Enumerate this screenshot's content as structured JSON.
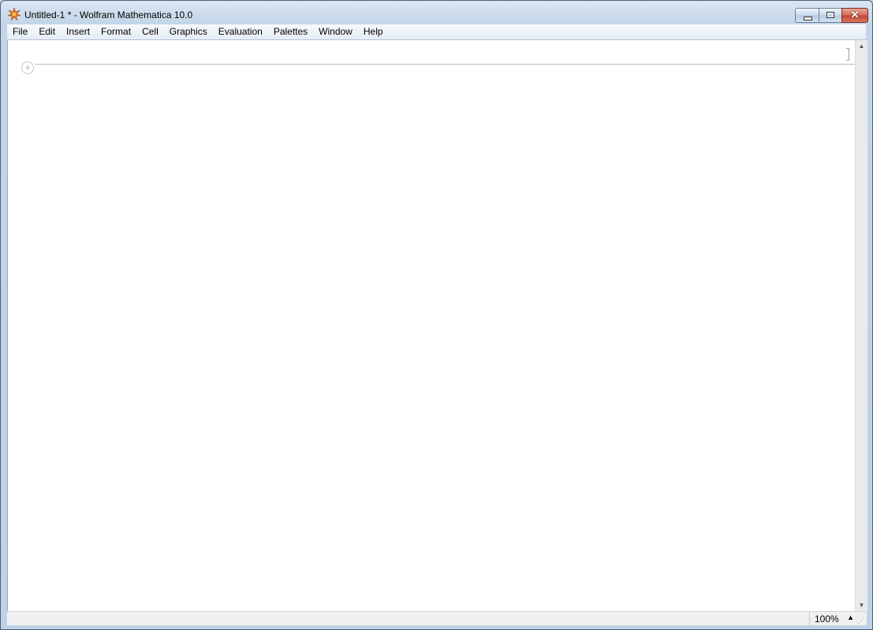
{
  "window": {
    "title": "Untitled-1 * - Wolfram Mathematica 10.0",
    "app_icon": "mathematica-spikey-icon",
    "controls": {
      "minimize": "minimize-icon",
      "maximize": "restore-icon",
      "close": "close-icon",
      "close_glyph": "✕"
    }
  },
  "menubar": {
    "items": [
      "File",
      "Edit",
      "Insert",
      "Format",
      "Cell",
      "Graphics",
      "Evaluation",
      "Palettes",
      "Window",
      "Help"
    ]
  },
  "notebook": {
    "insert_button": "+"
  },
  "scrollbar": {
    "up_arrow": "▲",
    "down_arrow": "▼"
  },
  "statusbar": {
    "zoom_label": "100%",
    "zoom_arrow": "▲",
    "grip": "⋰"
  },
  "colors": {
    "titlebar": "#c3d4e8",
    "close_button": "#c2452e",
    "notebook_background": "#ffffff",
    "spikey_orange": "#e87b1e"
  }
}
